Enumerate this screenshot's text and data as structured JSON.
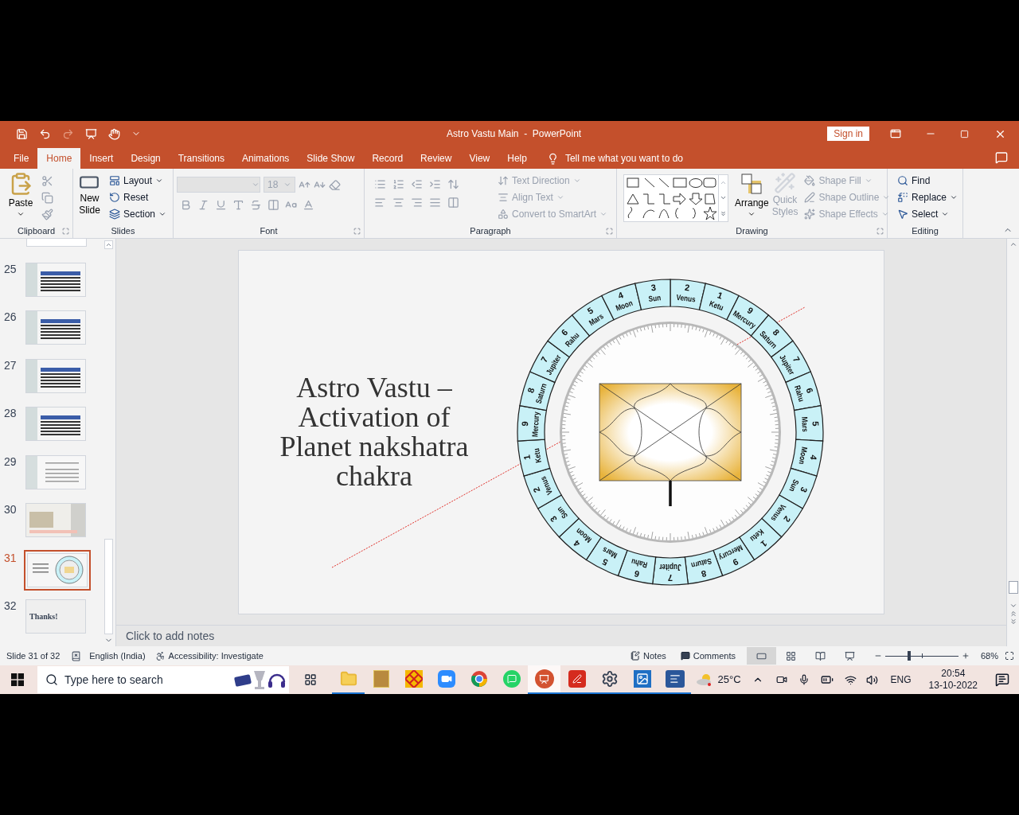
{
  "title_bar": {
    "title": "Astro Vastu Main  -  PowerPoint",
    "sign_in": "Sign in"
  },
  "tabs": [
    {
      "label": "File",
      "selected": false
    },
    {
      "label": "Home",
      "selected": true
    },
    {
      "label": "Insert",
      "selected": false
    },
    {
      "label": "Design",
      "selected": false
    },
    {
      "label": "Transitions",
      "selected": false
    },
    {
      "label": "Animations",
      "selected": false
    },
    {
      "label": "Slide Show",
      "selected": false
    },
    {
      "label": "Record",
      "selected": false
    },
    {
      "label": "Review",
      "selected": false
    },
    {
      "label": "View",
      "selected": false
    },
    {
      "label": "Help",
      "selected": false
    }
  ],
  "tell_me": "Tell me what you want to do",
  "ribbon": [
    {
      "kind": "clipboard",
      "label": "Clipboard",
      "paste": "Paste"
    },
    {
      "kind": "slides",
      "label": "Slides",
      "new_slide": "New Slide",
      "buttons": [
        {
          "kind": "layout",
          "label": "Layout",
          "dropdown": true,
          "disabled": false
        },
        {
          "kind": "reset",
          "label": "Reset",
          "dropdown": false,
          "disabled": false
        },
        {
          "kind": "section",
          "label": "Section",
          "dropdown": true,
          "disabled": false
        }
      ]
    },
    {
      "kind": "font",
      "label": "Font",
      "font_size": "18"
    },
    {
      "kind": "paragraph",
      "label": "Paragraph",
      "buttons": [
        {
          "kind": "text_direction",
          "label": "Text Direction",
          "dropdown": true,
          "disabled": true
        },
        {
          "kind": "align_text",
          "label": "Align Text",
          "dropdown": true,
          "disabled": true
        },
        {
          "kind": "smartart",
          "label": "Convert to SmartArt",
          "dropdown": true,
          "disabled": true
        }
      ]
    },
    {
      "kind": "drawing",
      "label": "Drawing",
      "arrange": "Arrange",
      "quick_styles": {
        "label": "Quick Styles",
        "disabled": true
      },
      "buttons": [
        {
          "kind": "fill",
          "label": "Shape Fill",
          "dropdown": true,
          "disabled": true
        },
        {
          "kind": "outline",
          "label": "Shape Outline",
          "dropdown": true,
          "disabled": true
        },
        {
          "kind": "effects",
          "label": "Shape Effects",
          "dropdown": true,
          "disabled": true
        }
      ]
    },
    {
      "kind": "editing",
      "label": "Editing",
      "buttons": [
        {
          "kind": "find",
          "label": "Find",
          "dropdown": false,
          "disabled": false
        },
        {
          "kind": "replace",
          "label": "Replace",
          "dropdown": true,
          "disabled": false
        },
        {
          "kind": "select",
          "label": "Select",
          "dropdown": true,
          "disabled": false
        }
      ]
    }
  ],
  "thumbnails": [
    {
      "number": "25",
      "kind": "table",
      "selected": false
    },
    {
      "number": "26",
      "kind": "table",
      "selected": false
    },
    {
      "number": "27",
      "kind": "table",
      "selected": false
    },
    {
      "number": "28",
      "kind": "table",
      "selected": false
    },
    {
      "number": "29",
      "kind": "text",
      "selected": false
    },
    {
      "number": "30",
      "kind": "photo_text",
      "selected": false
    },
    {
      "number": "31",
      "kind": "wheel",
      "selected": true
    },
    {
      "number": "32",
      "kind": "thanks",
      "selected": false,
      "text": "Thanks!"
    }
  ],
  "slide": {
    "title": "Astro Vastu – Activation of Planet nakshatra chakra",
    "wheel": [
      {
        "number": "2",
        "planet": "Venus"
      },
      {
        "number": "1",
        "planet": "Ketu"
      },
      {
        "number": "9",
        "planet": "Mercury"
      },
      {
        "number": "8",
        "planet": "Saturn"
      },
      {
        "number": "7",
        "planet": "Jupiter"
      },
      {
        "number": "6",
        "planet": "Rahu"
      },
      {
        "number": "5",
        "planet": "Mars"
      },
      {
        "number": "4",
        "planet": "Moon"
      },
      {
        "number": "3",
        "planet": "Sun"
      },
      {
        "number": "2",
        "planet": "Venus"
      },
      {
        "number": "1",
        "planet": "Ketu"
      },
      {
        "number": "9",
        "planet": "Mercury"
      },
      {
        "number": "8",
        "planet": "Saturn"
      },
      {
        "number": "7",
        "planet": "Jupiter"
      },
      {
        "number": "6",
        "planet": "Rahu"
      },
      {
        "number": "5",
        "planet": "Mars"
      },
      {
        "number": "4",
        "planet": "Moon"
      },
      {
        "number": "3",
        "planet": "Sun"
      },
      {
        "number": "2",
        "planet": "Venus"
      },
      {
        "number": "1",
        "planet": "Ketu"
      },
      {
        "number": "9",
        "planet": "Mercury"
      },
      {
        "number": "8",
        "planet": "Saturn"
      },
      {
        "number": "7",
        "planet": "Jupiter"
      },
      {
        "number": "6",
        "planet": "Rahu"
      },
      {
        "number": "5",
        "planet": "Mars"
      },
      {
        "number": "4",
        "planet": "Moon"
      },
      {
        "number": "3",
        "planet": "Sun"
      }
    ]
  },
  "notes_placeholder": "Click to add notes",
  "status": {
    "slide_info": "Slide 31 of 32",
    "language": "English (India)",
    "accessibility": "Accessibility: Investigate",
    "notes": "Notes",
    "comments": "Comments",
    "views": [
      {
        "kind": "normal",
        "selected": true
      },
      {
        "kind": "sorter",
        "selected": false
      },
      {
        "kind": "reading",
        "selected": false
      },
      {
        "kind": "slideshow",
        "selected": false
      }
    ],
    "zoom": {
      "level": 0.33,
      "reading": "68%"
    }
  },
  "taskbar": {
    "search_placeholder": "Type here to search",
    "apps": [
      {
        "kind": "explorer",
        "running": true,
        "active": false
      },
      {
        "kind": "photo_app",
        "running": false,
        "active": false
      },
      {
        "kind": "pattern_app",
        "running": false,
        "active": false
      },
      {
        "kind": "zoom",
        "running": false,
        "active": false
      },
      {
        "kind": "chrome",
        "running": false,
        "active": false
      },
      {
        "kind": "whatsapp",
        "running": false,
        "active": false
      },
      {
        "kind": "powerpoint",
        "running": true,
        "active": true
      },
      {
        "kind": "acrobat",
        "running": true,
        "active": false
      },
      {
        "kind": "settings",
        "running": true,
        "active": false
      },
      {
        "kind": "photos",
        "running": true,
        "active": false
      },
      {
        "kind": "word",
        "running": true,
        "active": false
      }
    ],
    "weather": "25°C",
    "language": "ENG",
    "time": "20:54",
    "date": "13-10-2022"
  }
}
